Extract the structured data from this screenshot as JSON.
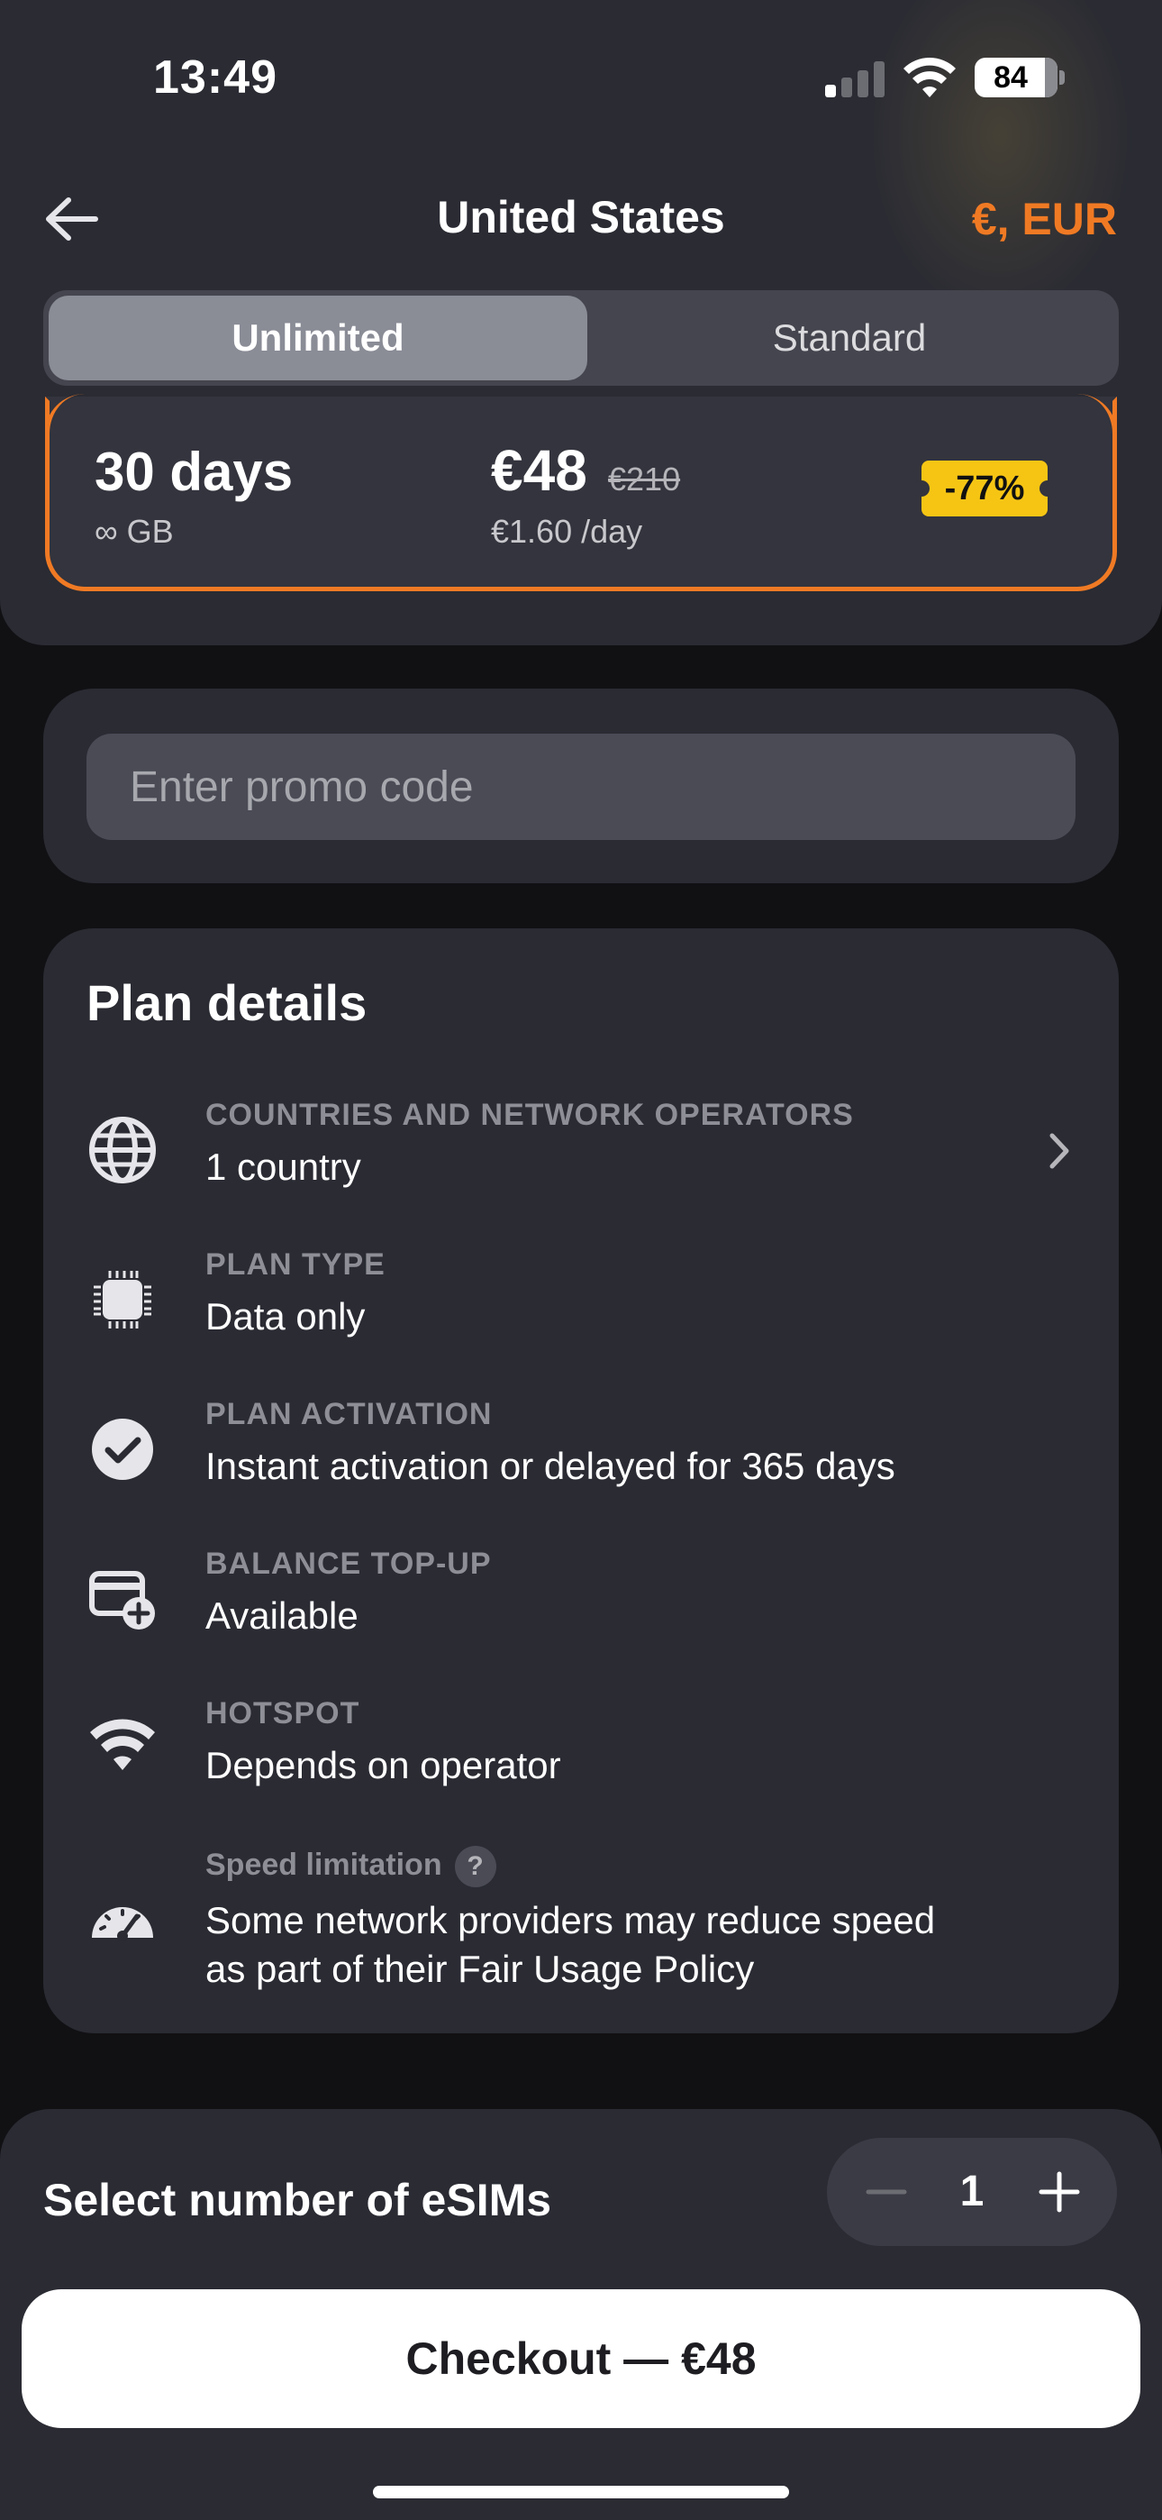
{
  "status_bar": {
    "time": "13:49",
    "battery": "84",
    "signal_bars_active": 1,
    "icons": [
      "cellular-signal-icon",
      "wifi-icon",
      "battery-icon"
    ]
  },
  "header": {
    "title": "United States",
    "currency": "€, EUR",
    "back_icon": "arrow-left-icon"
  },
  "tabs": [
    {
      "label": "Unlimited",
      "selected": true
    },
    {
      "label": "Standard",
      "selected": false
    }
  ],
  "plan": {
    "days": "30 days",
    "data": "∞ GB",
    "price": "€48",
    "old_price": "€210",
    "per_day": "€1.60 /day",
    "discount": "-77%"
  },
  "promo": {
    "placeholder": "Enter promo code",
    "value": ""
  },
  "details": {
    "title": "Plan details",
    "rows": [
      {
        "label": "COUNTRIES AND NETWORK OPERATORS",
        "value": "1  country",
        "icon": "globe-icon"
      },
      {
        "label": "PLAN TYPE",
        "value": "Data only",
        "icon": "chip-icon"
      },
      {
        "label": "PLAN ACTIVATION",
        "value": "Instant activation or delayed for 365 days",
        "icon": "check-circle-icon"
      },
      {
        "label": "BALANCE TOP-UP",
        "value": "Available",
        "icon": "card-add-icon"
      },
      {
        "label": "HOTSPOT",
        "value": "Depends on operator",
        "icon": "wifi-icon"
      },
      {
        "label": "Speed limitation",
        "value_line1": "Some network providers may reduce speed",
        "value_line2": "as part of their Fair Usage Policy",
        "icon": "speedometer-icon",
        "help": "?"
      }
    ]
  },
  "esims": {
    "label": "Select number of eSIMs",
    "count": "1"
  },
  "checkout": {
    "label": "Checkout — €48"
  },
  "colors": {
    "accent": "#f07a24",
    "badge": "#f6c514",
    "background": "#111114",
    "card": "#2a2b33"
  }
}
